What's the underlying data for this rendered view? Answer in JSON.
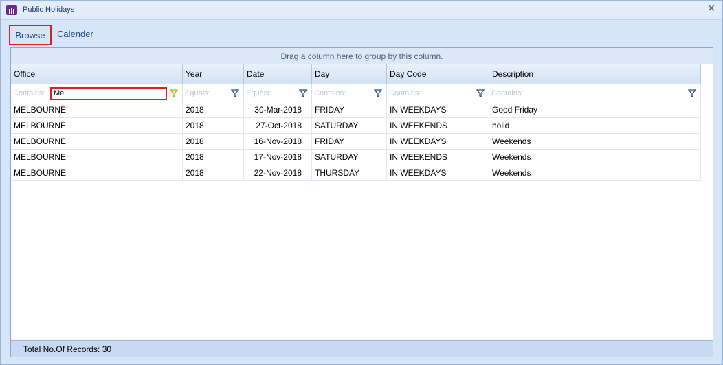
{
  "window": {
    "title": "Public Holidays",
    "close_glyph": "✕"
  },
  "tabs": [
    {
      "label": "Browse",
      "selected": true
    },
    {
      "label": "Calender",
      "selected": false
    }
  ],
  "grid": {
    "group_panel_text": "Drag a column here to group by this column.",
    "columns": [
      {
        "header": "Office",
        "filter_placeholder": "Contains:",
        "filter_value": "Mel"
      },
      {
        "header": "Year",
        "filter_placeholder": "Equals:"
      },
      {
        "header": "Date",
        "filter_placeholder": "Equals:"
      },
      {
        "header": "Day",
        "filter_placeholder": "Contains:"
      },
      {
        "header": "Day Code",
        "filter_placeholder": "Contains:"
      },
      {
        "header": "Description",
        "filter_placeholder": "Contains:"
      }
    ],
    "rows": [
      {
        "office": "MELBOURNE",
        "year": "2018",
        "date": "30-Mar-2018",
        "day": "FRIDAY",
        "day_code": "IN WEEKDAYS",
        "description": "Good Friday"
      },
      {
        "office": "MELBOURNE",
        "year": "2018",
        "date": "27-Oct-2018",
        "day": "SATURDAY",
        "day_code": "IN WEEKENDS",
        "description": "holid"
      },
      {
        "office": "MELBOURNE",
        "year": "2018",
        "date": "16-Nov-2018",
        "day": "FRIDAY",
        "day_code": "IN WEEKDAYS",
        "description": "Weekends"
      },
      {
        "office": "MELBOURNE",
        "year": "2018",
        "date": "17-Nov-2018",
        "day": "SATURDAY",
        "day_code": "IN WEEKENDS",
        "description": "Weekends"
      },
      {
        "office": "MELBOURNE",
        "year": "2018",
        "date": "22-Nov-2018",
        "day": "THURSDAY",
        "day_code": "IN WEEKDAYS",
        "description": "Weekends"
      }
    ],
    "footer_text": "Total No.Of Records: 30"
  },
  "colors": {
    "highlight": "#e11d1d",
    "active_filter_icon": "#c9a500",
    "filter_icon": "#2b4f80",
    "app_icon": "#6b2a86"
  },
  "icons": {
    "app": "app-logo-icon",
    "filter": "funnel-icon",
    "close": "close-icon"
  }
}
